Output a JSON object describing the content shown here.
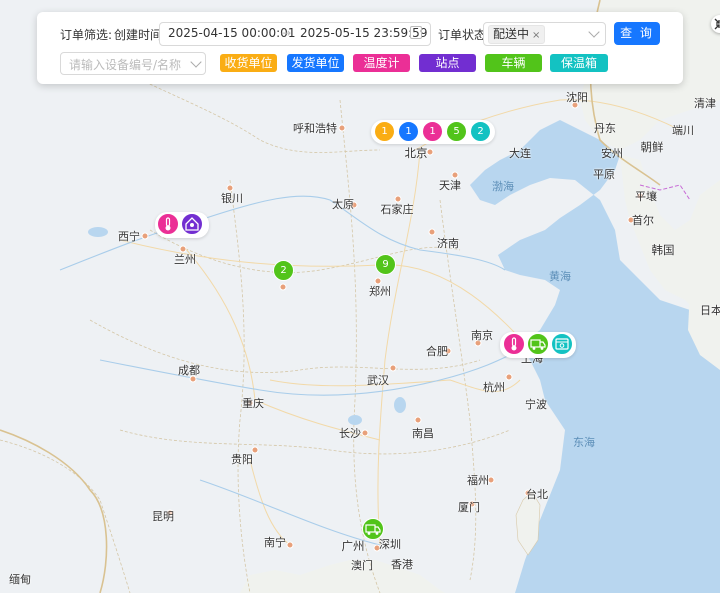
{
  "filter": {
    "label": "订单筛选:",
    "created_label": "创建时间",
    "start_time": "2025-04-15 00:00:01",
    "range_arrow": "→",
    "end_time": "2025-05-15 23:59:59",
    "status_label": "订单状态",
    "status_selected": "配送中",
    "status_clear": "×",
    "query_label": "查 询",
    "device_placeholder": "请输入设备编号/名称",
    "layer_buttons": [
      {
        "label": "收货单位",
        "color": "#faad14"
      },
      {
        "label": "发货单位",
        "color": "#1677ff"
      },
      {
        "label": "温度计",
        "color": "#eb2f96"
      },
      {
        "label": "站点",
        "color": "#722ed1"
      },
      {
        "label": "车辆",
        "color": "#52c41a"
      },
      {
        "label": "保温箱",
        "color": "#13c2c2"
      }
    ]
  },
  "clusters": {
    "beijing": [
      "1",
      "1",
      "1",
      "5",
      "2"
    ],
    "xian": "2",
    "zhengzhou": "9"
  },
  "map": {
    "cities": [
      "沈阳",
      "呼和浩特",
      "北京",
      "天津",
      "银川",
      "太原",
      "石家庄",
      "西宁",
      "兰州",
      "济南",
      "郑州",
      "南京",
      "合肥",
      "成都",
      "武汉",
      "杭州",
      "重庆",
      "长沙",
      "南昌",
      "贵阳",
      "福州",
      "昆明",
      "厦门",
      "台北",
      "广州",
      "南宁",
      "深圳",
      "澳门",
      "香港",
      "宁波",
      "大连",
      "平壤",
      "首尔",
      "朝鲜",
      "韩国",
      "安州",
      "平原",
      "丹东",
      "端川",
      "清津",
      "缅甸",
      "日本"
    ],
    "seas": [
      "渤海",
      "黄海",
      "东海",
      "上海"
    ]
  }
}
